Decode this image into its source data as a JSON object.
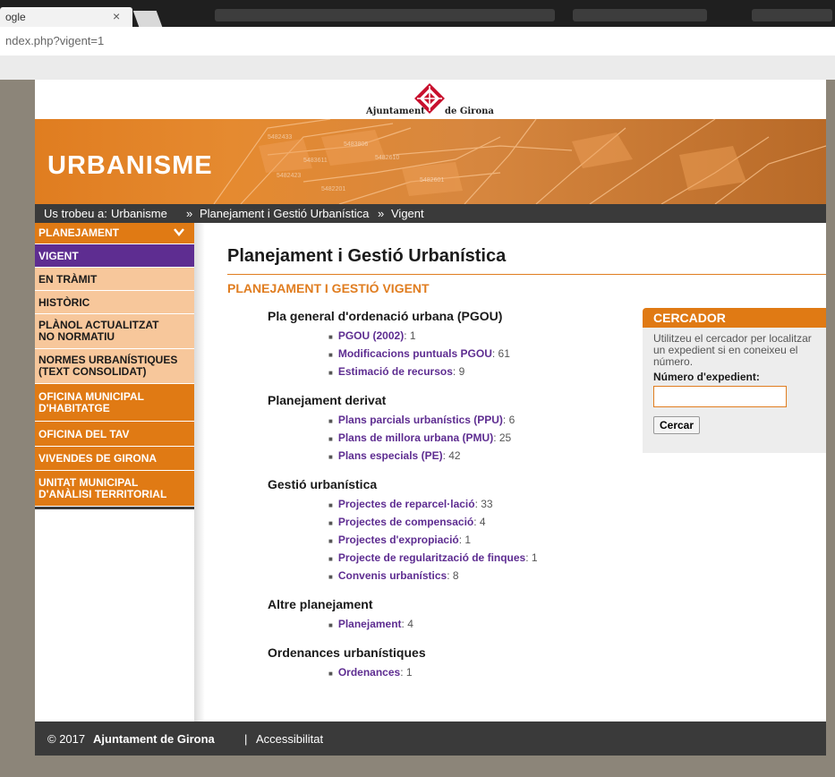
{
  "browser": {
    "tab_title": "ogle",
    "tab_close": "×",
    "url": "ndex.php?vigent=1"
  },
  "header": {
    "logo_left": "Ajuntament",
    "logo_right": "de Girona",
    "banner_title": "URBANISME"
  },
  "breadcrumb": {
    "prefix": "Us trobeu a:",
    "items": [
      "Urbanisme",
      "Planejament i Gestió Urbanística",
      "Vigent"
    ],
    "separator": "»"
  },
  "sidebar": {
    "items": [
      {
        "label": "PLANEJAMENT",
        "style": "orange",
        "chevron": true
      },
      {
        "label": "VIGENT",
        "style": "purple"
      },
      {
        "label": "EN TRÀMIT",
        "style": "beige"
      },
      {
        "label": "HISTÒRIC",
        "style": "beige"
      },
      {
        "label": "PLÀNOL ACTUALITZAT NO NORMATIU",
        "style": "beige"
      },
      {
        "label": "NORMES URBANÍSTIQUES (TEXT CONSOLIDAT)",
        "style": "beige"
      },
      {
        "label": "OFICINA MUNICIPAL D'HABITATGE",
        "style": "orange"
      },
      {
        "label": "OFICINA DEL TAV",
        "style": "orange"
      },
      {
        "label": "VIVENDES DE GIRONA",
        "style": "orange"
      },
      {
        "label": "UNITAT MUNICIPAL D'ANÀLISI TERRITORIAL",
        "style": "orange"
      }
    ]
  },
  "main": {
    "title": "Planejament i Gestió Urbanística",
    "subtitle": "PLANEJAMENT I GESTIÓ VIGENT",
    "sections": [
      {
        "title": "Pla general d'ordenació urbana (PGOU)",
        "items": [
          {
            "label": "PGOU (2002)",
            "count": ": 1"
          },
          {
            "label": "Modificacions puntuals PGOU",
            "count": ": 61"
          },
          {
            "label": "Estimació de recursos",
            "count": ": 9"
          }
        ]
      },
      {
        "title": "Planejament derivat",
        "items": [
          {
            "label": "Plans parcials urbanístics (PPU)",
            "count": ": 6"
          },
          {
            "label": "Plans de millora urbana (PMU)",
            "count": ": 25"
          },
          {
            "label": "Plans especials (PE)",
            "count": ": 42"
          }
        ]
      },
      {
        "title": "Gestió urbanística",
        "items": [
          {
            "label": "Projectes de reparcel·lació",
            "count": ": 33"
          },
          {
            "label": "Projectes de compensació",
            "count": ": 4"
          },
          {
            "label": "Projectes d'expropiació",
            "count": ": 1"
          },
          {
            "label": "Projecte de regularització de finques",
            "count": ": 1"
          },
          {
            "label": "Convenis urbanístics",
            "count": ": 8"
          }
        ]
      },
      {
        "title": "Altre planejament",
        "items": [
          {
            "label": "Planejament",
            "count": ": 4"
          }
        ]
      },
      {
        "title": "Ordenances urbanístiques",
        "items": [
          {
            "label": "Ordenances",
            "count": ": 1"
          }
        ]
      }
    ]
  },
  "search": {
    "title": "CERCADOR",
    "text": "Utilitzeu el cercador per localitzar un expedient si en coneixeu el número.",
    "label": "Número d'expedient:",
    "value": "",
    "button": "Cercar"
  },
  "footer": {
    "copyright": "© 2017",
    "org": "Ajuntament de Girona",
    "separator": "|",
    "link": "Accessibilitat"
  },
  "colors": {
    "accent": "#e07d20",
    "purple": "#5e2d91",
    "dark": "#3a3a3a",
    "beige": "#f7c79b"
  }
}
